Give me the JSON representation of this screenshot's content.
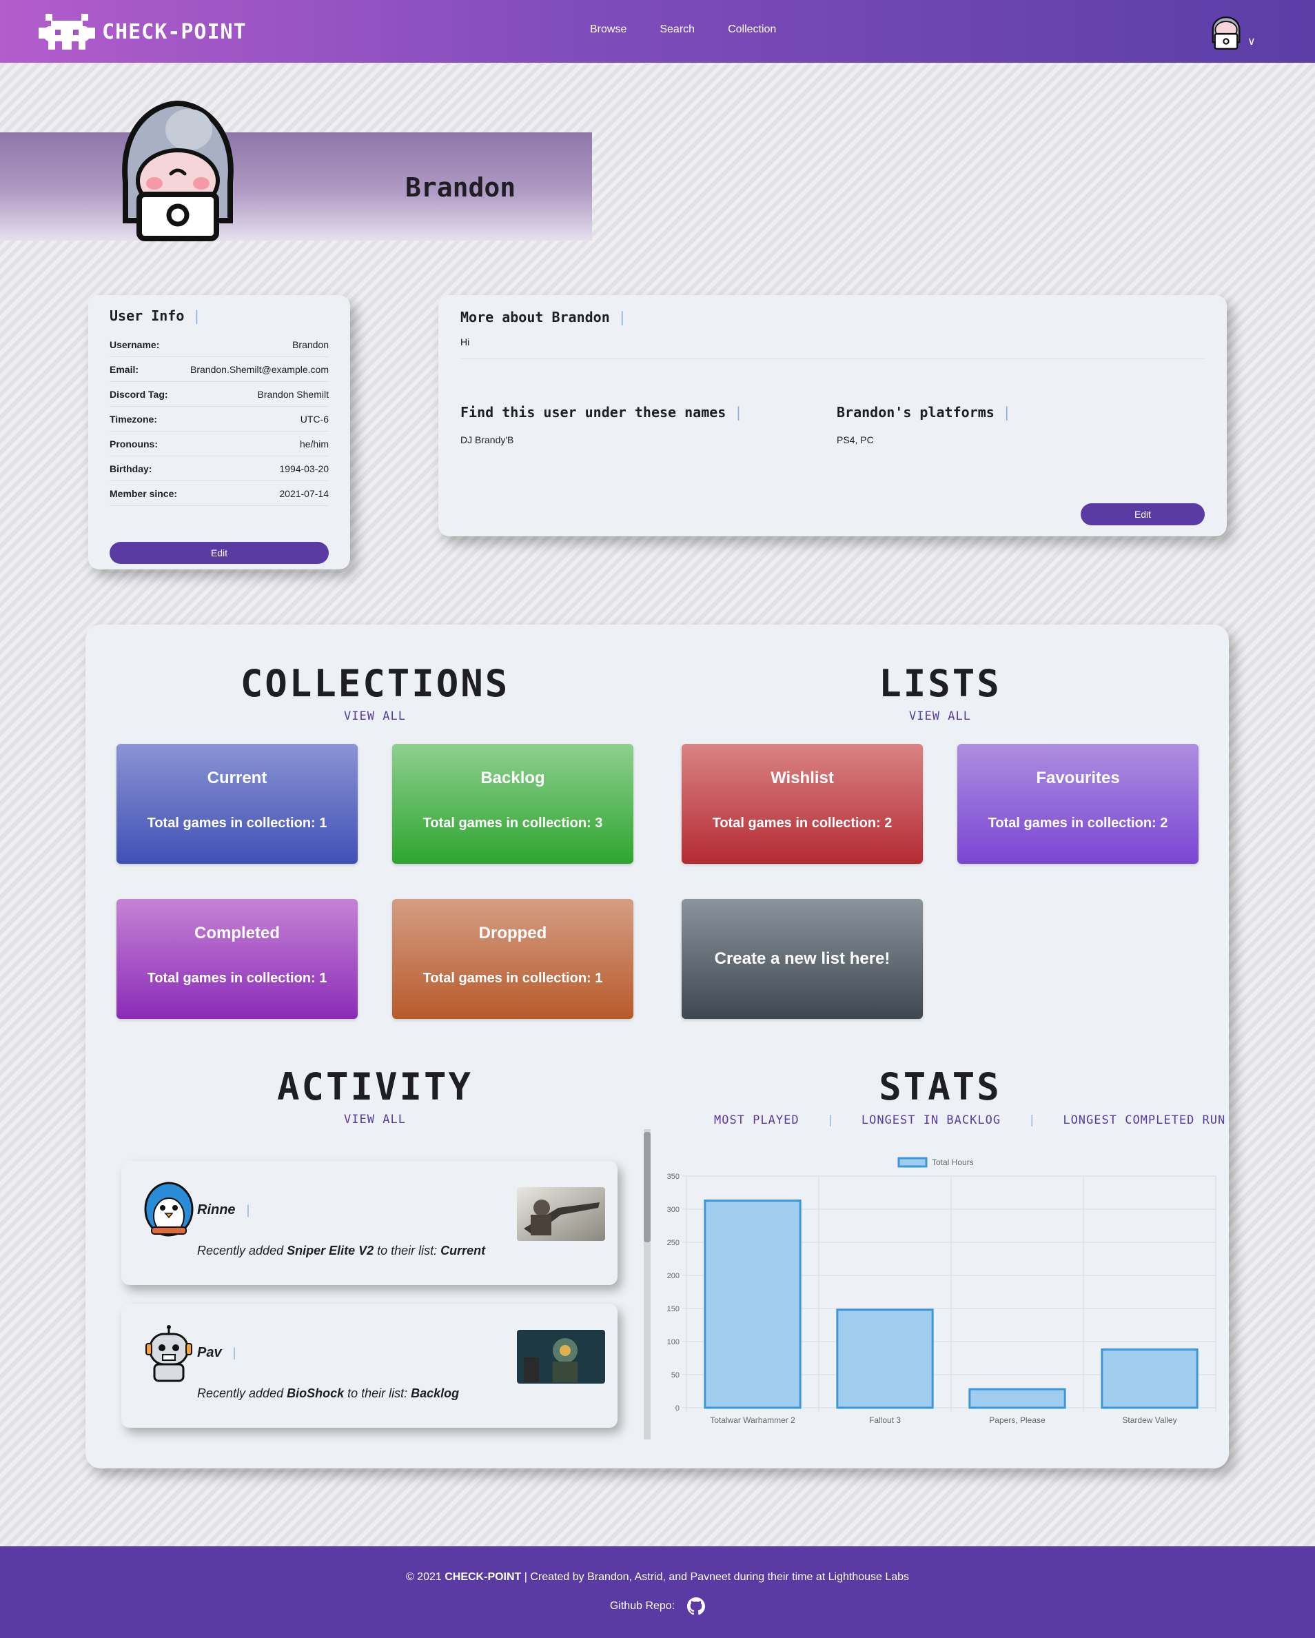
{
  "nav": {
    "brand": "CHECK-POINT",
    "links": [
      "Browse",
      "Search",
      "Collection"
    ],
    "profile_icon": "avatar-icon"
  },
  "profile": {
    "name": "Brandon"
  },
  "user_info": {
    "title": "User Info",
    "rows": [
      {
        "label": "Username:",
        "value": "Brandon"
      },
      {
        "label": "Email:",
        "value": "Brandon.Shemilt@example.com"
      },
      {
        "label": "Discord Tag:",
        "value": "Brandon Shemilt"
      },
      {
        "label": "Timezone:",
        "value": "UTC-6"
      },
      {
        "label": "Pronouns:",
        "value": "he/him"
      },
      {
        "label": "Birthday:",
        "value": "1994-03-20"
      },
      {
        "label": "Member since:",
        "value": "2021-07-14"
      }
    ],
    "edit_label": "Edit"
  },
  "about": {
    "title": "More about Brandon",
    "text": "Hi",
    "names_title": "Find this user under these names",
    "names": "DJ Brandy'B",
    "platforms_title": "Brandon's platforms",
    "platforms": "PS4, PC",
    "edit_label": "Edit"
  },
  "collections": {
    "title": "COLLECTIONS",
    "view_all": "VIEW ALL",
    "tiles": [
      {
        "name": "Current",
        "count": "Total games in collection: 1",
        "gradient": [
          "#8b94d4",
          "#4050b5"
        ]
      },
      {
        "name": "Backlog",
        "count": "Total games in collection: 3",
        "gradient": [
          "#8ed08f",
          "#2ea52e"
        ]
      },
      {
        "name": "Completed",
        "count": "Total games in collection: 1",
        "gradient": [
          "#c583d4",
          "#8a2bb8"
        ]
      },
      {
        "name": "Dropped",
        "count": "Total games in collection: 1",
        "gradient": [
          "#d49e84",
          "#b85a2b"
        ]
      }
    ]
  },
  "lists": {
    "title": "LISTS",
    "view_all": "VIEW ALL",
    "tiles": [
      {
        "name": "Wishlist",
        "count": "Total games in collection: 2",
        "gradient": [
          "#d98484",
          "#b52a33"
        ]
      },
      {
        "name": "Favourites",
        "count": "Total games in collection: 2",
        "gradient": [
          "#ad8fe0",
          "#7a45d4"
        ]
      }
    ],
    "create_label": "Create a new list here!",
    "create_gradient": [
      "#8b949c",
      "#3f4750"
    ]
  },
  "activity": {
    "title": "ACTIVITY",
    "view_all": "VIEW ALL",
    "items": [
      {
        "user": "Rinne",
        "prefix": "Recently added ",
        "game": "Sniper Elite V2",
        "middle": " to their list: ",
        "list": "Current"
      },
      {
        "user": "Pav",
        "prefix": "Recently added ",
        "game": "BioShock",
        "middle": " to their list: ",
        "list": "Backlog"
      }
    ]
  },
  "stats": {
    "title": "STATS",
    "tabs": [
      "MOST PLAYED",
      "LONGEST IN BACKLOG",
      "LONGEST COMPLETED RUN"
    ]
  },
  "chart_data": {
    "type": "bar",
    "categories": [
      "Totalwar Warhammer 2",
      "Fallout 3",
      "Papers, Please",
      "Stardew Valley"
    ],
    "series": [
      {
        "name": "Total Hours",
        "values": [
          313,
          148,
          28,
          88
        ]
      }
    ],
    "ylim": [
      0,
      350
    ],
    "yticks": [
      0,
      50,
      100,
      150,
      200,
      250,
      300,
      350
    ],
    "grid": true,
    "legend": "top",
    "bar_fill": "#a0cdee",
    "bar_stroke": "#3a97dd"
  },
  "footer": {
    "copyright": "© 2021 ",
    "brand": "CHECK-POINT",
    "credits": " | Created by Brandon, Astrid, and Pavneet during their time at Lighthouse Labs",
    "github_label": "Github Repo:",
    "github_icon": "github-icon"
  }
}
